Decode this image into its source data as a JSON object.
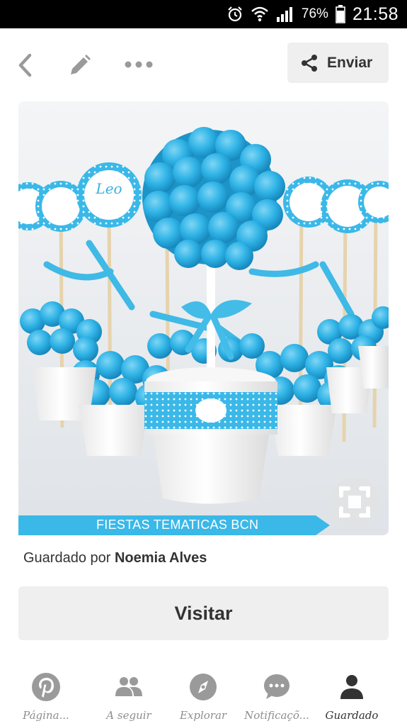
{
  "status_bar": {
    "battery_percent": "76%",
    "time": "21:58"
  },
  "toolbar": {
    "send_label": "Enviar"
  },
  "pin": {
    "watermark": "FIESTAS TEMATICAS BCN",
    "tag_name": "Leo",
    "saved_by_prefix": "Guardado por",
    "saved_by_user": "Noemia Alves"
  },
  "visit_label": "Visitar",
  "bottom_nav": {
    "items": [
      {
        "label": "Página..."
      },
      {
        "label": "A seguir"
      },
      {
        "label": "Explorar"
      },
      {
        "label": "Notificaçõ..."
      },
      {
        "label": "Guardado"
      }
    ]
  },
  "colors": {
    "accent_blue": "#29b0e3",
    "button_bg": "#efefef",
    "text_dark": "#333333",
    "nav_inactive": "#8e8e8e"
  }
}
